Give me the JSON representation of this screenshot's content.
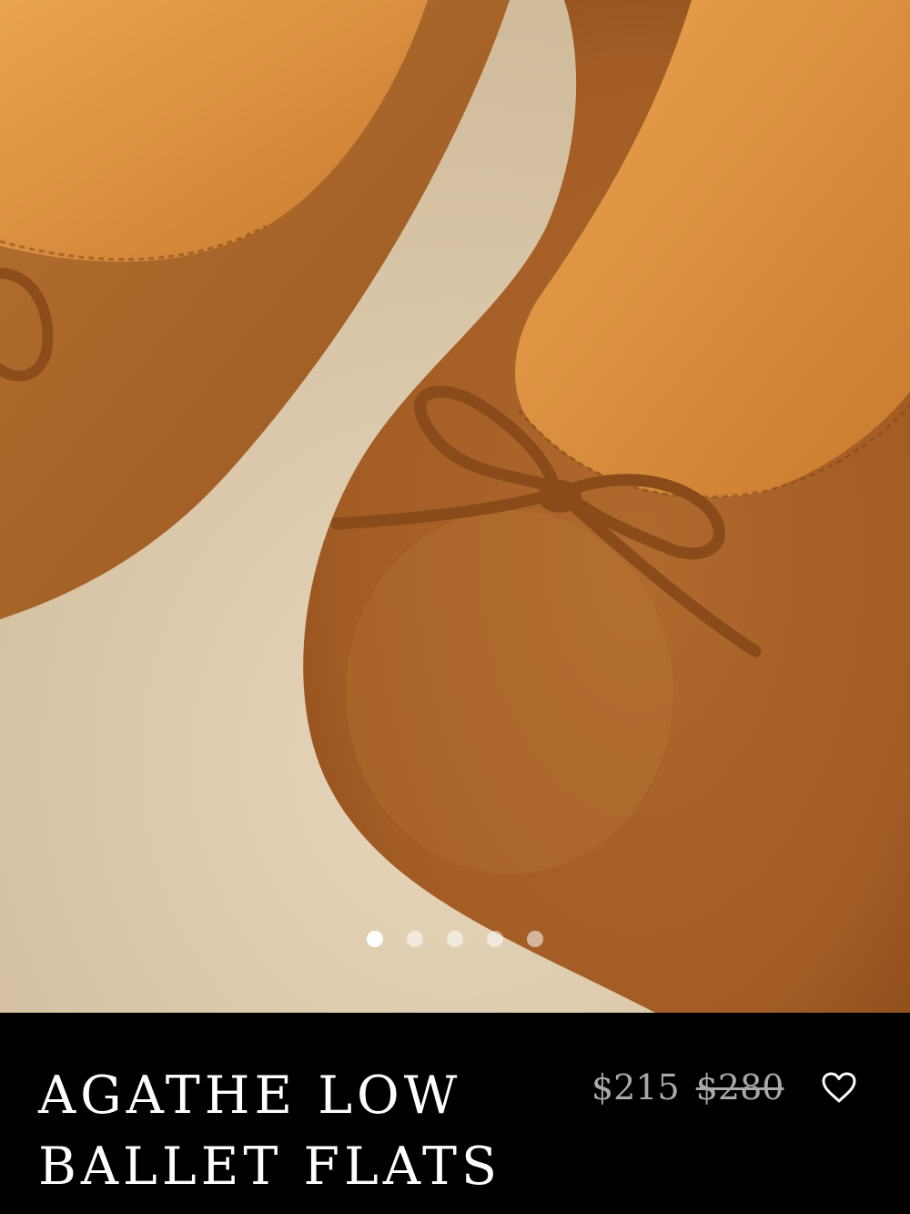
{
  "product": {
    "title_line1": "AGATHE LOW",
    "title_line2": "BALLET FLATS",
    "price_sale": "$215",
    "price_original": "$280"
  },
  "gallery": {
    "image_count": 5,
    "active_index": 0
  },
  "icons": {
    "wishlist": "heart-outline-icon"
  },
  "colors": {
    "background_panel": "#000000",
    "title_text": "#ffffff",
    "price_text": "#a9a9a9",
    "suede": "#a9622a",
    "lining": "#d9913f",
    "canvas": "#d9c7a8"
  }
}
